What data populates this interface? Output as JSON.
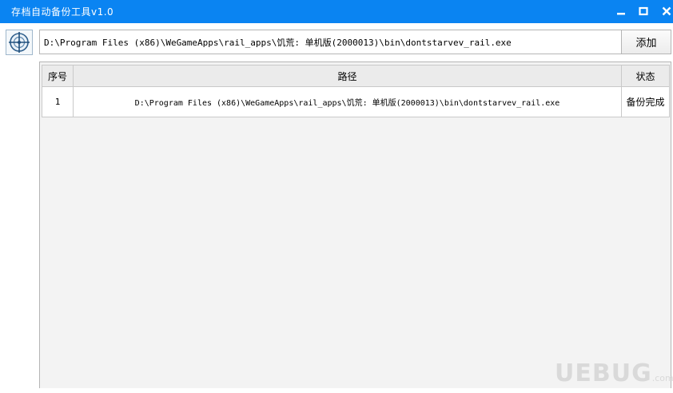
{
  "window": {
    "title": "存档自动备份工具v1.0",
    "controls": {
      "minimize": "minimize-icon",
      "maximize": "maximize-icon",
      "close": "close-icon"
    }
  },
  "toolbar": {
    "app_icon": "crosshair-target-icon",
    "path_value": "D:\\Program Files (x86)\\WeGameApps\\rail_apps\\饥荒: 单机版(2000013)\\bin\\dontstarvev_rail.exe",
    "add_label": "添加"
  },
  "table": {
    "columns": [
      "序号",
      "路径",
      "状态"
    ],
    "rows": [
      {
        "index": "1",
        "path": "D:\\Program  Files  (x86)\\WeGameApps\\rail_apps\\饥荒: 单机版(2000013)\\bin\\dontstarvev_rail.exe",
        "status": "备份完成"
      }
    ]
  },
  "watermark": {
    "text": "UEBUG",
    "sub": ".com"
  },
  "colors": {
    "titlebar": "#0a84f2",
    "border": "#b5b5b5",
    "grid_bg": "#f3f3f3"
  }
}
